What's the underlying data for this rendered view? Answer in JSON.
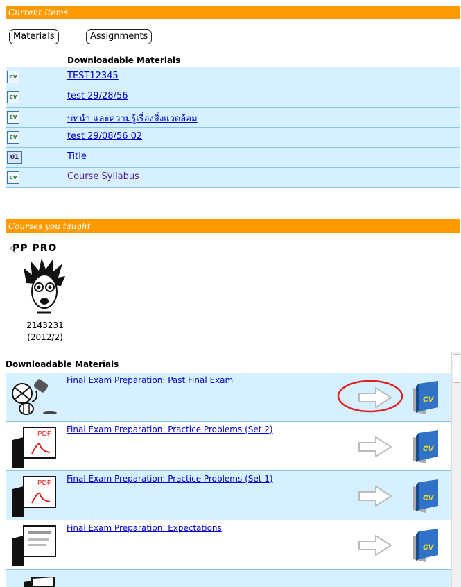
{
  "current_items": {
    "header": "Current Items",
    "buttons": {
      "materials": "Materials",
      "assignments": "Assignments"
    },
    "downloadable_header": "Downloadable Materials",
    "rows": [
      {
        "icon": "cv-doc-icon",
        "icon_text": "cv",
        "label": "TEST12345"
      },
      {
        "icon": "cv-doc-icon",
        "icon_text": "cv",
        "label": "test 29/28/56"
      },
      {
        "icon": "cv-doc-icon",
        "icon_text": "cv",
        "label": "บทนำ และความรู้เรื่องสิ่งแวดล้อม"
      },
      {
        "icon": "cv-doc-icon",
        "icon_text": "cv",
        "label": "test 29/08/56 02"
      },
      {
        "icon": "title-slide-icon",
        "icon_text": "01",
        "label": "Title"
      },
      {
        "icon": "cv-doc-icon",
        "icon_text": "cv",
        "label": "Course Syllabus"
      }
    ]
  },
  "courses_taught": {
    "header": "Courses you taught",
    "course": {
      "code": "PP PRO",
      "number": "2143231",
      "term": "(2012/2)"
    }
  },
  "materials": {
    "header": "Downloadable Materials",
    "rows": [
      {
        "thumb": "exam-thumb-icon",
        "label": "Final Exam Preparation: Past Final Exam",
        "highlighted": true
      },
      {
        "thumb": "pdf-thumb-icon",
        "label": "Final Exam Preparation: Practice Problems (Set 2)",
        "highlighted": false
      },
      {
        "thumb": "pdf-thumb-icon",
        "label": "Final Exam Preparation: Practice Problems (Set 1)",
        "highlighted": false
      },
      {
        "thumb": "slide-thumb-icon",
        "label": "Final Exam Preparation: Expectations",
        "highlighted": false
      }
    ]
  },
  "colors": {
    "header_bar": "#ff9a00",
    "row_blue": "#d6f0ff",
    "link": "#0000cc",
    "highlight_circle": "#e02020"
  }
}
